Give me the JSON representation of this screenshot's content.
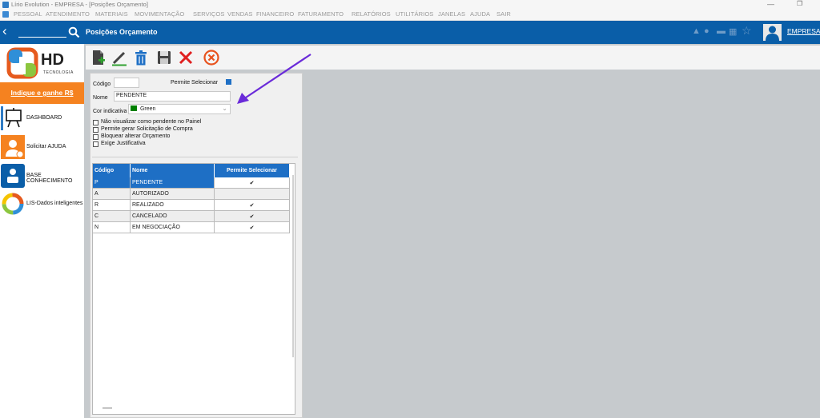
{
  "window": {
    "title": "Lírio Evolution - EMPRESA - [Posições Orçamento]",
    "menu": [
      "PESSOAL",
      "ATENDIMENTO",
      "MATERIAIS",
      "MOVIMENTAÇÃO",
      "SERVIÇOS",
      "VENDAS",
      "FINANCEIRO",
      "FATURAMENTO",
      "RELATÓRIOS",
      "UTILITÁRIOS",
      "JANELAS",
      "AJUDA",
      "SAIR"
    ]
  },
  "header": {
    "page_title": "Posições Orçamento",
    "user": "EMPRESA",
    "colors": {
      "bar": "#0a5ea8",
      "accent": "#1e6fc5",
      "promo": "#f58220"
    }
  },
  "sidebar": {
    "logo_text": "HD",
    "logo_sub": "TECNOLOGIA",
    "promo": "Indique e ganhe R$",
    "items": [
      {
        "label": "DASHBOARD",
        "icon": "presentation-board-icon"
      },
      {
        "label": "Solicitar AJUDA",
        "icon": "support-agent-icon"
      },
      {
        "label": "BASE CONHECIMENTO",
        "icon": "knowledge-base-icon"
      },
      {
        "label": "LIS-Dados inteligentes",
        "icon": "data-ring-icon"
      }
    ]
  },
  "toolbar": {
    "buttons": [
      {
        "name": "new-document",
        "icon": "new-document-icon"
      },
      {
        "name": "edit",
        "icon": "pencil-icon"
      },
      {
        "name": "delete",
        "icon": "trash-icon"
      },
      {
        "name": "save",
        "icon": "floppy-icon"
      },
      {
        "name": "cancel",
        "icon": "close-x-icon"
      },
      {
        "name": "exit",
        "icon": "circle-x-icon"
      }
    ]
  },
  "form": {
    "codigo_label": "Código",
    "codigo_value": "",
    "permite_label": "Permite Selecionar",
    "permite_checked": true,
    "nome_label": "Nome",
    "nome_value": "PENDENTE",
    "cor_label": "Cor indicativa",
    "cor_value": "Green",
    "cor_swatch": "#008000",
    "checkboxes": [
      {
        "label": "Não visualizar como pendente no Painel",
        "checked": false
      },
      {
        "label": "Permite gerar Solicitação de Compra",
        "checked": false
      },
      {
        "label": "Bloquear alterar Orçamento",
        "checked": false
      },
      {
        "label": "Exige Justificativa",
        "checked": false
      }
    ]
  },
  "grid": {
    "headers": [
      "Código",
      "Nome",
      "Permite Selecionar"
    ],
    "rows": [
      {
        "codigo": "P",
        "nome": "PENDENTE",
        "permite": "✔"
      },
      {
        "codigo": "A",
        "nome": "AUTORIZADO",
        "permite": ""
      },
      {
        "codigo": "R",
        "nome": "REALIZADO",
        "permite": "✔"
      },
      {
        "codigo": "C",
        "nome": "CANCELADO",
        "permite": "✔"
      },
      {
        "codigo": "N",
        "nome": "EM NEGOCIAÇÃO",
        "permite": "✔"
      }
    ]
  }
}
